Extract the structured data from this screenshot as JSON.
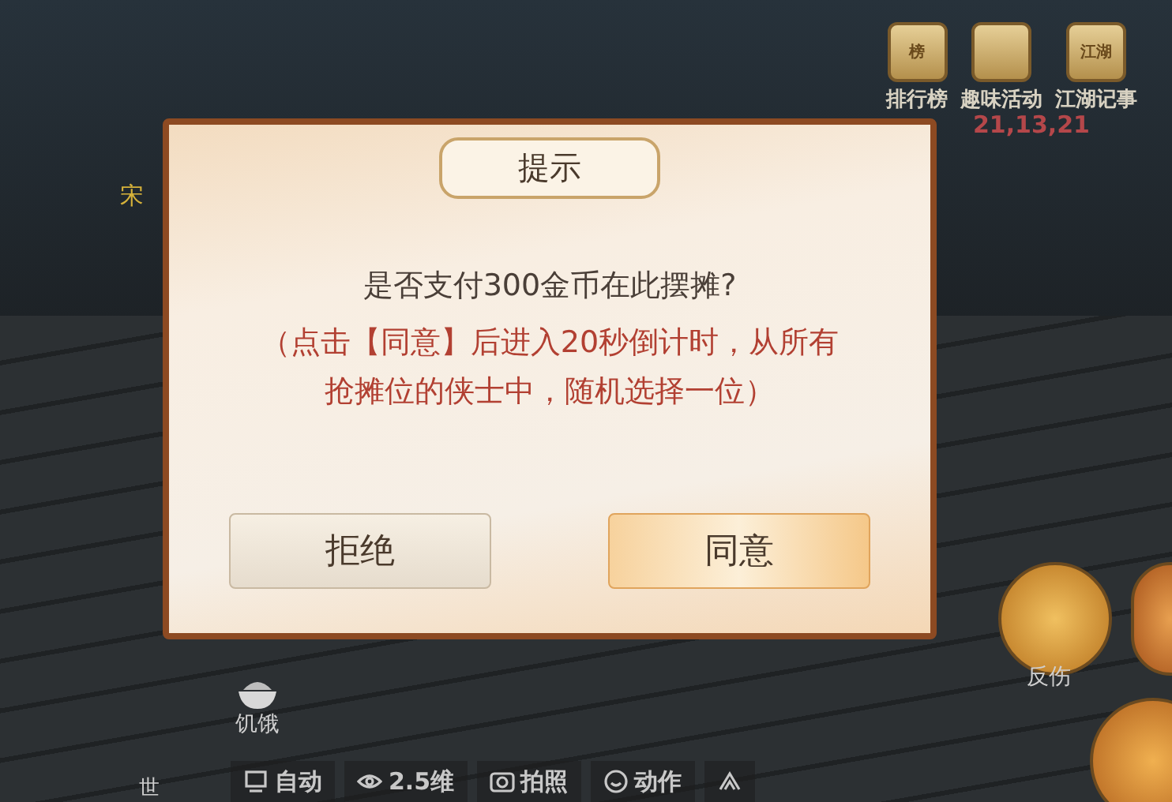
{
  "top_menu": [
    {
      "label": "排行榜",
      "glyph": "榜"
    },
    {
      "label": "趣味活动"
    },
    {
      "label": "江湖记事",
      "glyph": "江湖"
    }
  ],
  "timer": "21,13,21",
  "side_label": "宋",
  "dialog": {
    "title": "提示",
    "question": "是否支付300金币在此摆摊?",
    "note": "（点击【同意】后进入20秒倒计时，从所有抢摊位的侠士中，随机选择一位）",
    "buttons": [
      {
        "label": "拒绝",
        "kind": "secondary"
      },
      {
        "label": "同意",
        "kind": "primary"
      }
    ]
  },
  "status": {
    "label": "饥饿"
  },
  "skills": [
    {
      "label": "反伤"
    }
  ],
  "chat_label": "世",
  "bottom_bar": [
    {
      "label": "自动",
      "kind": "monitor"
    },
    {
      "label": "2.5维",
      "kind": "eye"
    },
    {
      "label": "拍照",
      "kind": "camera"
    },
    {
      "label": "动作",
      "kind": "smile"
    },
    {
      "kind": "up"
    }
  ]
}
